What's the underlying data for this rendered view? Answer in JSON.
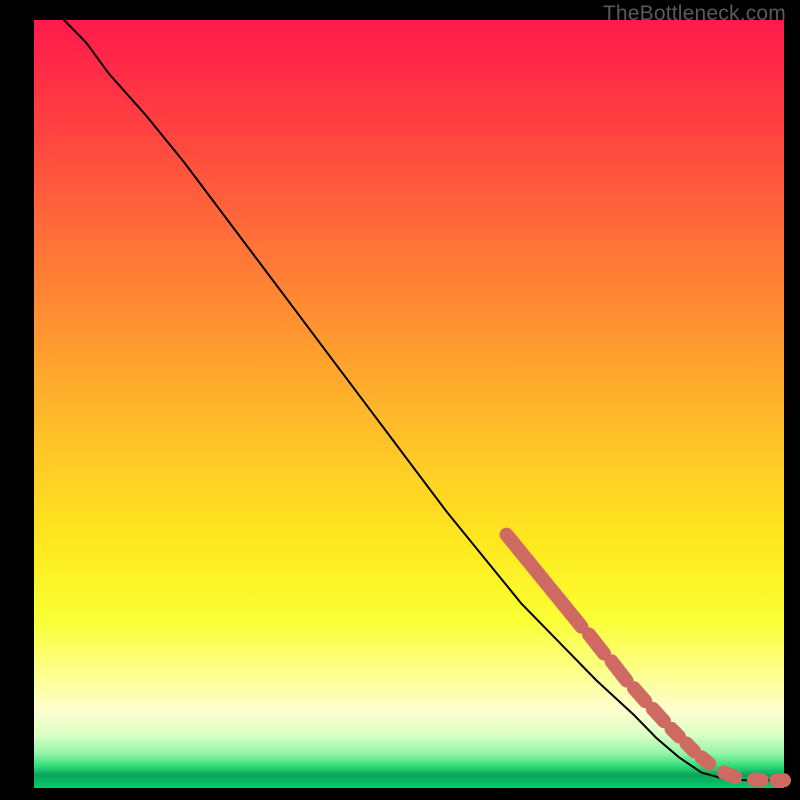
{
  "watermark": "TheBottleneck.com",
  "chart_data": {
    "type": "line",
    "title": "",
    "xlabel": "",
    "ylabel": "",
    "xlim": [
      0,
      100
    ],
    "ylim": [
      0,
      100
    ],
    "grid": false,
    "series": [
      {
        "name": "curve",
        "color": "#000000",
        "x": [
          4,
          7,
          10,
          15,
          20,
          25,
          30,
          35,
          40,
          45,
          50,
          55,
          60,
          65,
          70,
          75,
          80,
          83,
          86,
          89,
          92,
          95,
          98,
          100
        ],
        "y": [
          100,
          97,
          93,
          87.5,
          81.5,
          75,
          68.5,
          62,
          55.5,
          49,
          42.5,
          36,
          30,
          24,
          19,
          14,
          9.5,
          6.5,
          4,
          2,
          1.2,
          1,
          1,
          1
        ]
      }
    ],
    "markers": [
      {
        "name": "highlight-segments",
        "color": "#cf6a63",
        "segments": [
          {
            "x0": 63,
            "y0": 33,
            "x1": 73,
            "y1": 21
          },
          {
            "x0": 74,
            "y0": 20,
            "x1": 76,
            "y1": 17.5
          },
          {
            "x0": 77,
            "y0": 16.5,
            "x1": 79,
            "y1": 14
          },
          {
            "x0": 80,
            "y0": 13,
            "x1": 81.5,
            "y1": 11.3
          },
          {
            "x0": 82.5,
            "y0": 10.3,
            "x1": 84,
            "y1": 8.7
          },
          {
            "x0": 85,
            "y0": 7.7,
            "x1": 86,
            "y1": 6.7
          },
          {
            "x0": 87,
            "y0": 5.8,
            "x1": 88,
            "y1": 4.8
          },
          {
            "x0": 89,
            "y0": 4.0,
            "x1": 90,
            "y1": 3.2
          },
          {
            "x0": 92,
            "y0": 2.0,
            "x1": 93.5,
            "y1": 1.4
          },
          {
            "x0": 96,
            "y0": 1.1,
            "x1": 97,
            "y1": 1.05
          },
          {
            "x0": 99,
            "y0": 1.0,
            "x1": 100,
            "y1": 1.0
          }
        ]
      }
    ]
  }
}
